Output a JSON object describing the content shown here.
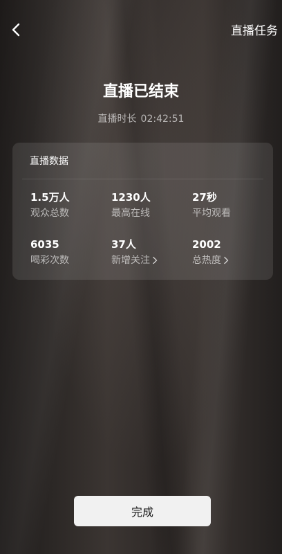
{
  "header": {
    "back_icon": "chevron-left-icon",
    "task_label": "直播任务"
  },
  "title": "直播已结束",
  "duration": {
    "label": "直播时长",
    "value": "02:42:51"
  },
  "stats_card": {
    "title": "直播数据",
    "stats": [
      {
        "value": "1.5万人",
        "label": "观众总数",
        "has_arrow": false
      },
      {
        "value": "1230人",
        "label": "最高在线",
        "has_arrow": false
      },
      {
        "value": "27秒",
        "label": "平均观看",
        "has_arrow": false
      },
      {
        "value": "6035",
        "label": "喝彩次数",
        "has_arrow": false
      },
      {
        "value": "37人",
        "label": "新增关注",
        "has_arrow": true
      },
      {
        "value": "2002",
        "label": "总热度",
        "has_arrow": true
      }
    ]
  },
  "done_button": "完成",
  "colors": {
    "background": "#2b2725",
    "card": "rgba(255,255,255,0.10)",
    "button": "#f1f1f1",
    "secondary_text": "rgba(255,255,255,0.62)"
  }
}
